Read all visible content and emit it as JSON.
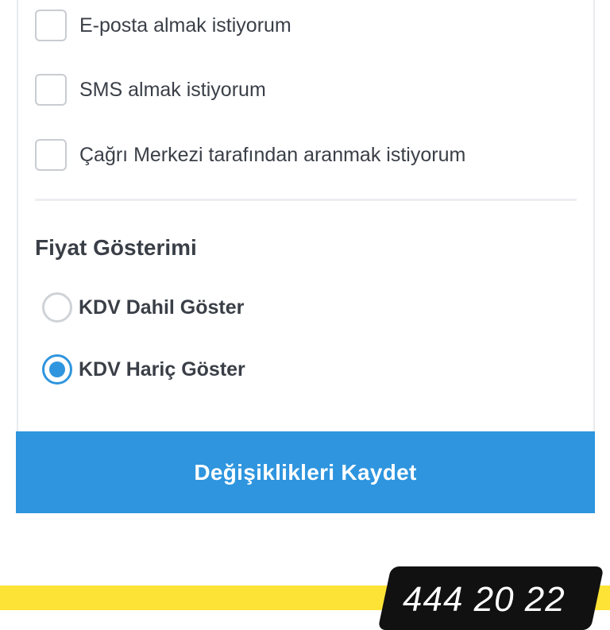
{
  "preferences": {
    "checkboxes": [
      {
        "label": "E-posta almak istiyorum",
        "checked": false
      },
      {
        "label": "SMS almak istiyorum",
        "checked": false
      },
      {
        "label": "Çağrı Merkezi tarafından aranmak istiyorum",
        "checked": false
      }
    ]
  },
  "price_display": {
    "title": "Fiyat Gösterimi",
    "options": [
      {
        "label": "KDV Dahil Göster",
        "selected": false
      },
      {
        "label": "KDV Hariç Göster",
        "selected": true
      }
    ]
  },
  "save_button": {
    "label": "Değişiklikleri Kaydet",
    "color": "#2e95de"
  },
  "footer": {
    "phone": "444 20 22",
    "band_color": "#fde336"
  }
}
